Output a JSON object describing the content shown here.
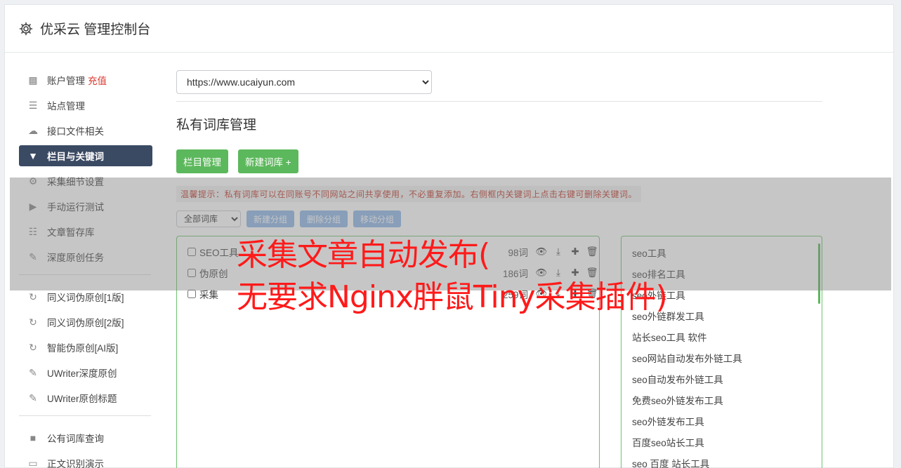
{
  "header": {
    "title": "优采云 管理控制台"
  },
  "sidebar": {
    "items": [
      {
        "label": "账户管理",
        "badge": "充值",
        "icon": "bar-chart-icon"
      },
      {
        "label": "站点管理",
        "icon": "server-icon"
      },
      {
        "label": "接口文件相关",
        "icon": "cloud-upload-icon"
      },
      {
        "label": "栏目与关键词",
        "icon": "filter-icon"
      },
      {
        "label": "采集细节设置",
        "icon": "gears-icon"
      },
      {
        "label": "手动运行测试",
        "icon": "play-circle-icon"
      },
      {
        "label": "文章暂存库",
        "icon": "database-icon"
      },
      {
        "label": "深度原创任务",
        "icon": "edit-icon"
      },
      {
        "label": "同义词伪原创[1版]",
        "icon": "refresh-icon"
      },
      {
        "label": "同义词伪原创[2版]",
        "icon": "refresh-icon"
      },
      {
        "label": "智能伪原创[AI版]",
        "icon": "refresh-icon"
      },
      {
        "label": "UWriter深度原创",
        "icon": "edit-icon"
      },
      {
        "label": "UWriter原创标题",
        "icon": "edit-icon"
      },
      {
        "label": "公有词库查询",
        "icon": "book-icon"
      },
      {
        "label": "正文识别演示",
        "icon": "monitor-icon"
      }
    ]
  },
  "main": {
    "site_select": "https://www.ucaiyun.com",
    "page_title": "私有词库管理",
    "buttons": {
      "columns": "栏目管理",
      "new_lib": "新建词库 +"
    },
    "tip": "温馨提示：私有词库可以在同账号不同网站之间共享使用，不必重复添加。右侧框内关键词上点击右键可删除关键词。",
    "group_select": "全部词库",
    "group_buttons": {
      "new": "新建分组",
      "delete": "删除分组",
      "move": "移动分组"
    },
    "libraries": [
      {
        "name": "SEO工具",
        "count": "98词"
      },
      {
        "name": "伪原创",
        "count": "186词"
      },
      {
        "name": "采集",
        "count": "259词"
      }
    ],
    "keywords": [
      "seo工具",
      "seo排名工具",
      "seo外链工具",
      "seo外链群发工具",
      "站长seo工具 软件",
      "seo网站自动发布外链工具",
      "seo自动发布外链工具",
      "免费seo外链发布工具",
      "seo外链发布工具",
      "百度seo站长工具",
      "seo 百度 站长工具"
    ]
  },
  "overlay": {
    "line1": "采集文章自动发布(",
    "line2": "无要求Nginx胖鼠Tiny采集插件)"
  },
  "colors": {
    "accent_green": "#5cb85c",
    "active_nav": "#3b4a63",
    "overlay_red": "#ff1a1a",
    "tip_red": "#c0392b"
  }
}
